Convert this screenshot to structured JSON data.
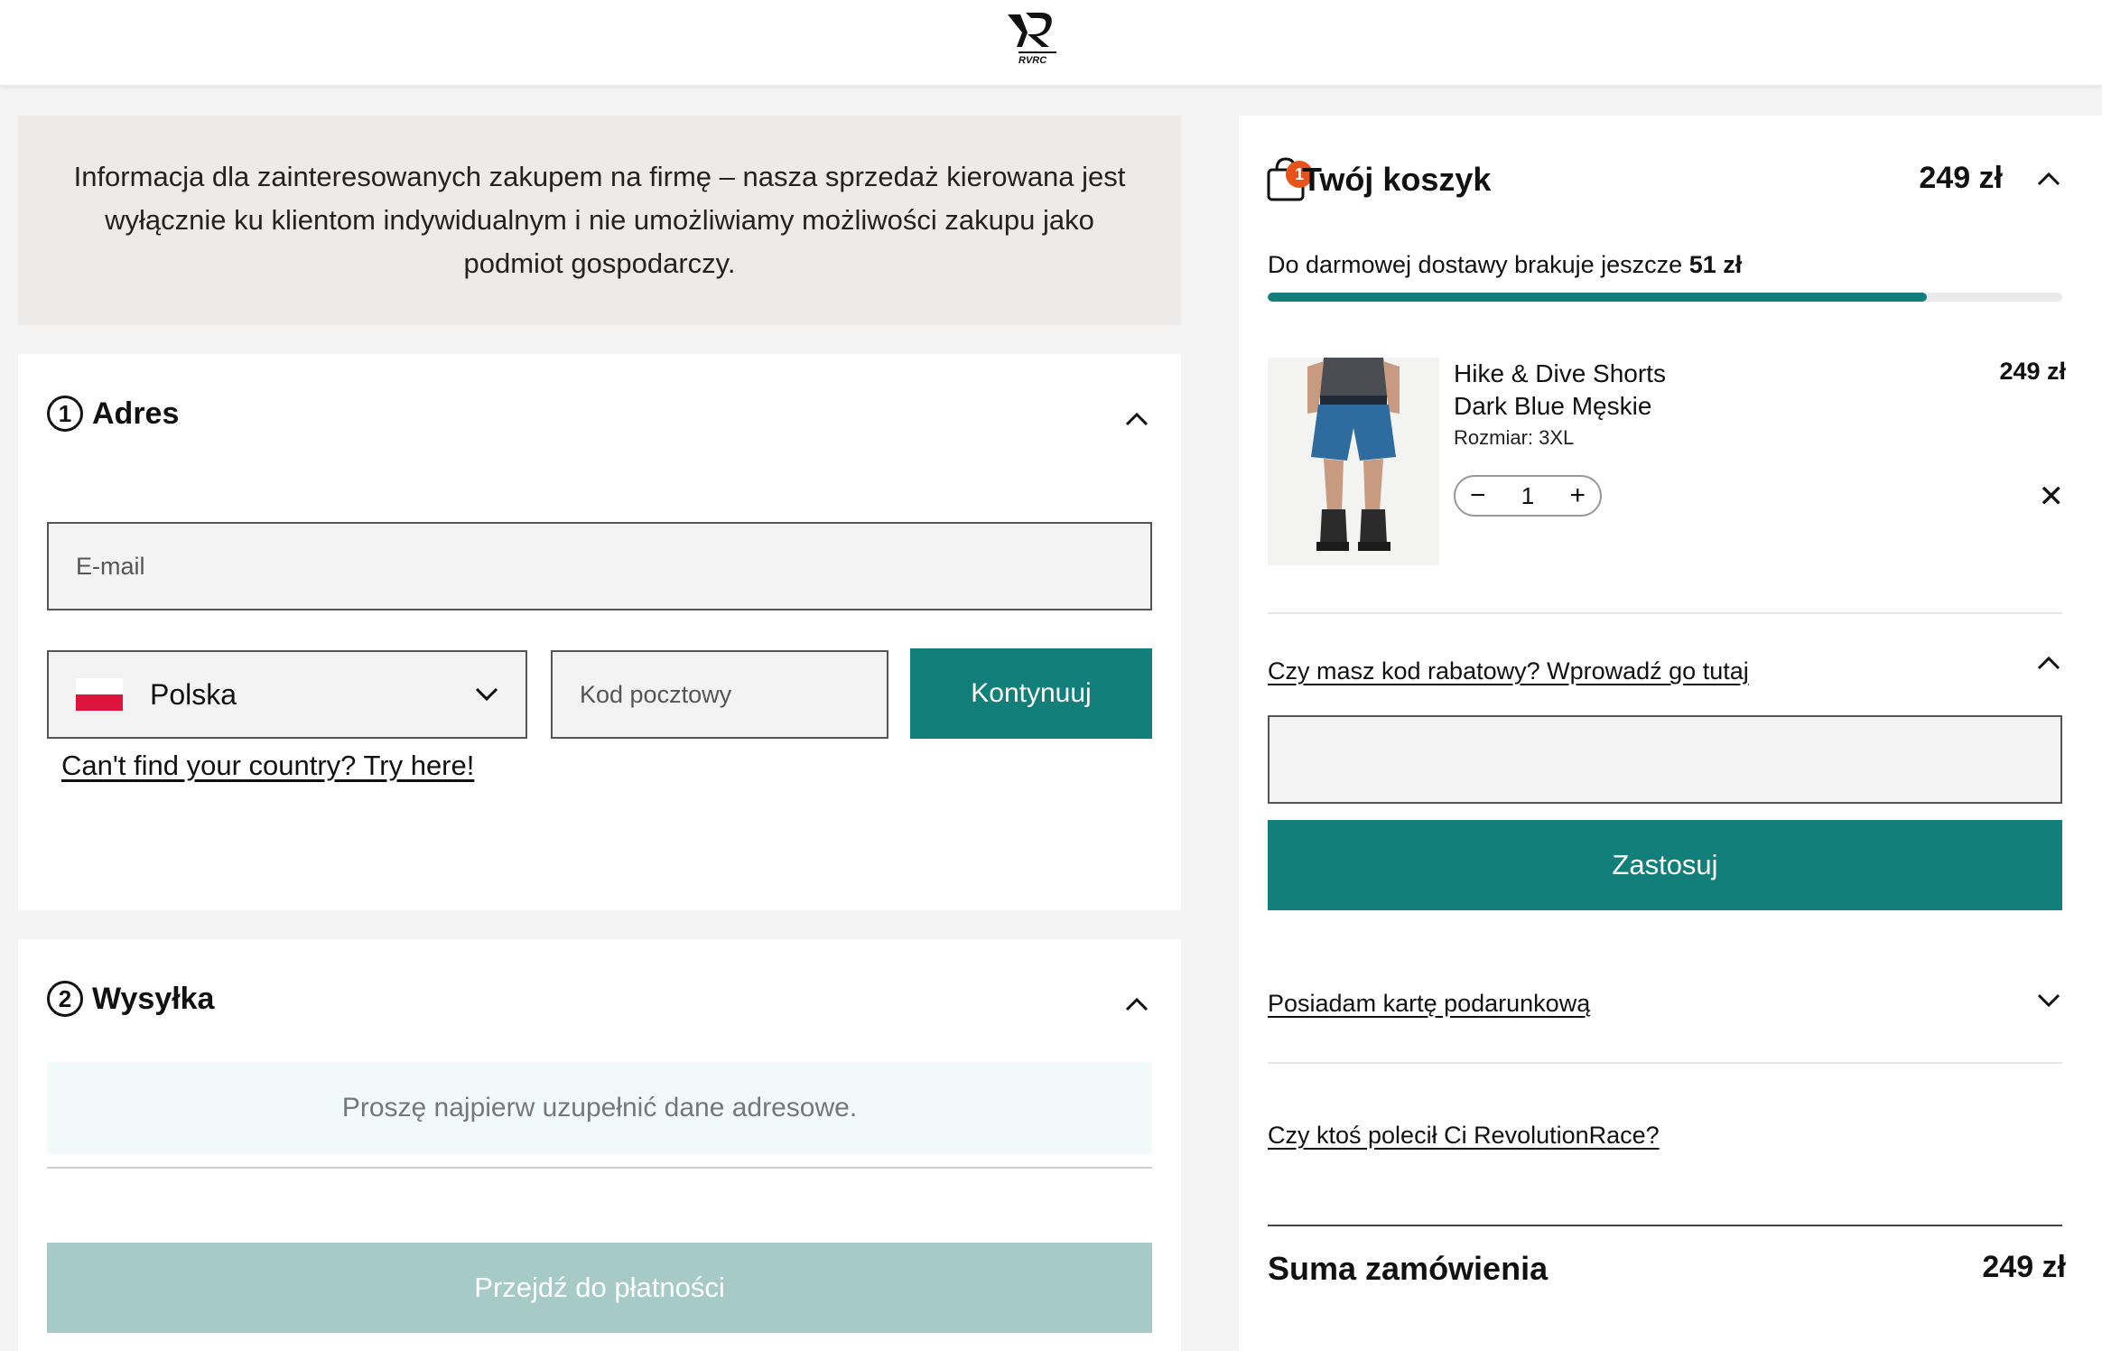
{
  "header": {
    "logo_text": "RVRC"
  },
  "notice": {
    "text": "Informacja dla zainteresowanych zakupem na firmę – nasza sprzedaż kierowana jest wyłącznie ku klientom indywidualnym i nie umożliwiamy możliwości zakupu jako podmiot gospodarczy."
  },
  "address": {
    "step_number": "1",
    "title": "Adres",
    "email_placeholder": "E-mail",
    "country": "Polska",
    "postal_placeholder": "Kod pocztowy",
    "continue_label": "Kontynuuj",
    "country_link": "Can't find your country? Try here!"
  },
  "shipping": {
    "step_number": "2",
    "title": "Wysyłka",
    "info": "Proszę najpierw uzupełnić dane adresowe.",
    "pay_button": "Przejdź do płatności"
  },
  "cart": {
    "title": "Twój koszyk",
    "badge_count": "1",
    "total_top": "249 zł",
    "shipping_text": "Do darmowej dostawy brakuje jeszcze",
    "shipping_amount": "51 zł",
    "shipping_progress": 0.83,
    "item": {
      "name_line1": "Hike & Dive Shorts",
      "name_line2": "Dark Blue Męskie",
      "size": "Rozmiar: 3XL",
      "price": "249 zł",
      "quantity": "1"
    },
    "discount_link": "Czy masz kod rabatowy? Wprowadź go tutaj",
    "apply_label": "Zastosuj",
    "gift_card_link": "Posiadam kartę podarunkową",
    "referral_link": "Czy ktoś polecił Ci RevolutionRace?",
    "sum_label": "Suma zamówienia",
    "sum_value": "249 zł"
  },
  "colors": {
    "accent": "#137f7b",
    "accent_disabled": "#a5cac7",
    "badge": "#e8531c"
  }
}
